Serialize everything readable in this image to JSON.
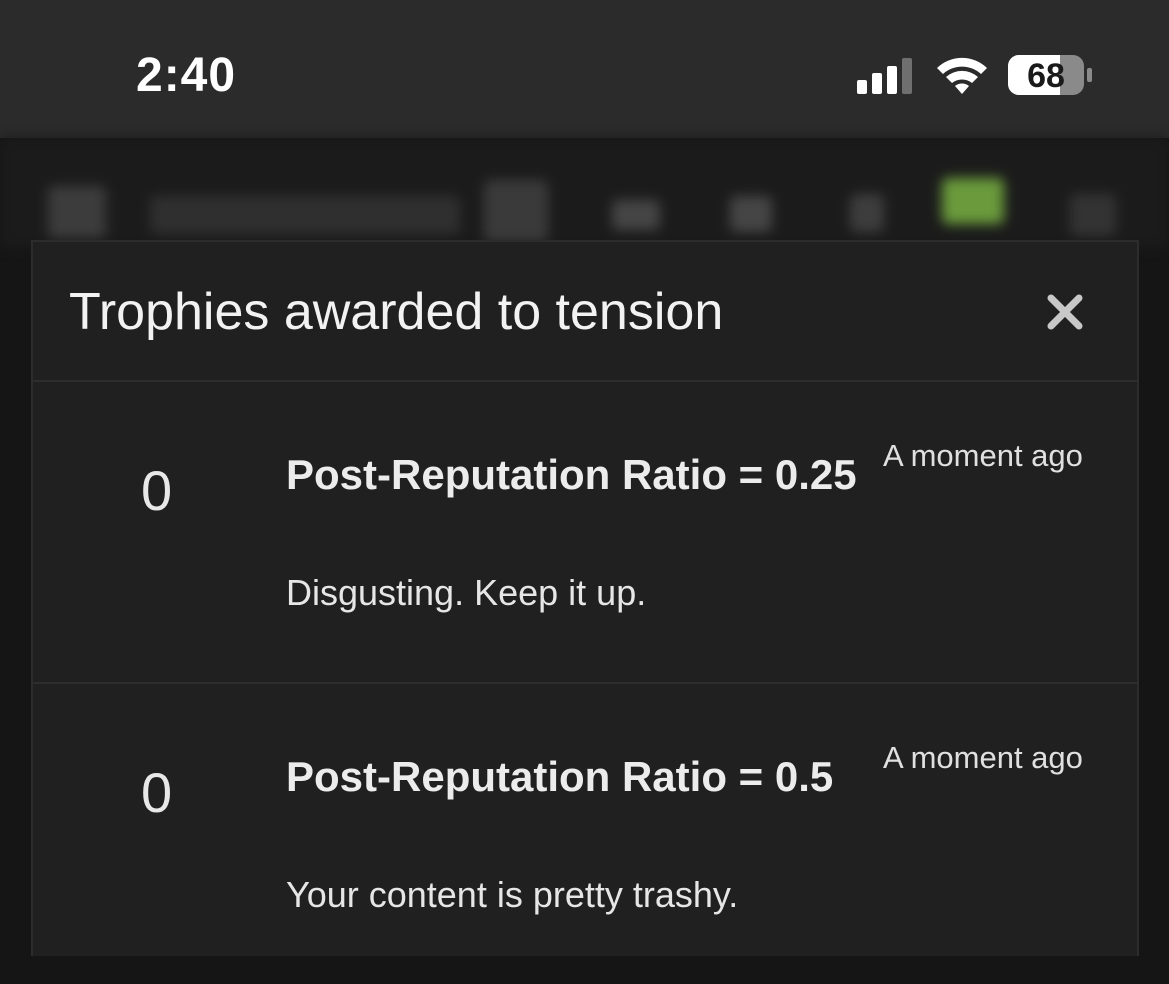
{
  "status_bar": {
    "time": "2:40",
    "battery_level": "68",
    "signal_icon": "cellular-signal-icon",
    "wifi_icon": "wifi-icon"
  },
  "modal": {
    "title": "Trophies awarded to tension",
    "close_icon": "close-icon",
    "trophies": [
      {
        "points": "0",
        "title": "Post-Reputation Ratio = 0.25",
        "description": "Disgusting. Keep it up.",
        "time": "A moment ago"
      },
      {
        "points": "0",
        "title": "Post-Reputation Ratio = 0.5",
        "description": "Your content is pretty trashy.",
        "time": "A moment ago"
      }
    ]
  },
  "colors": {
    "status_bar_bg": "#2b2b2b",
    "modal_bg": "#202020",
    "text": "#ececec",
    "blurred_accent": "#6a9a3c"
  }
}
